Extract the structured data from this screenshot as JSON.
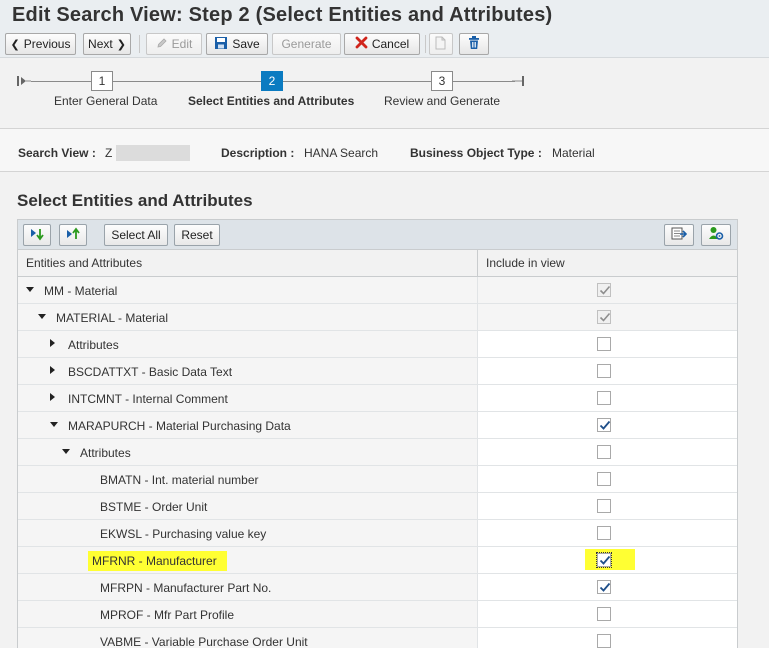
{
  "page": {
    "title": "Edit Search View: Step 2  (Select Entities and Attributes)"
  },
  "toolbar": {
    "previous": "Previous",
    "next": "Next",
    "edit": "Edit",
    "save": "Save",
    "generate": "Generate",
    "cancel": "Cancel",
    "icons": [
      "chevron-left-icon",
      "chevron-right-icon",
      "pencil-icon",
      "save-icon",
      "cancel-x-icon",
      "copy-icon",
      "trash-icon"
    ]
  },
  "roadmap": {
    "steps": [
      {
        "number": "1",
        "label": "Enter General Data",
        "active": false
      },
      {
        "number": "2",
        "label": "Select Entities and Attributes",
        "active": true
      },
      {
        "number": "3",
        "label": "Review and Generate",
        "active": false
      }
    ],
    "active_color": "#0b7bc1"
  },
  "header": {
    "search_view_label": "Search View :",
    "search_view_value": "Z",
    "description_label": "Description :",
    "description_value": "HANA Search",
    "bo_type_label": "Business Object Type :",
    "bo_type_value": "Material"
  },
  "section": {
    "title": "Select Entities and Attributes"
  },
  "table_toolbar": {
    "select_all": "Select All",
    "reset": "Reset",
    "icons": [
      "expand-down-icon",
      "collapse-up-icon",
      "export-icon",
      "user-settings-icon"
    ]
  },
  "table": {
    "columns": [
      "Entities and Attributes",
      "Include in view"
    ],
    "rows": [
      {
        "label": "MM - Material",
        "expander": "down",
        "checked": true,
        "disabled": true,
        "highlight": false
      },
      {
        "label": "MATERIAL - Material",
        "expander": "down",
        "checked": true,
        "disabled": true,
        "highlight": false
      },
      {
        "label": "Attributes",
        "expander": "right",
        "checked": false,
        "disabled": false,
        "highlight": false
      },
      {
        "label": "BSCDATTXT - Basic Data Text",
        "expander": "right",
        "checked": false,
        "disabled": false,
        "highlight": false
      },
      {
        "label": "INTCMNT - Internal Comment",
        "expander": "right",
        "checked": false,
        "disabled": false,
        "highlight": false
      },
      {
        "label": "MARAPURCH - Material Purchasing Data",
        "expander": "down",
        "checked": true,
        "disabled": false,
        "highlight": false
      },
      {
        "label": "Attributes",
        "expander": "down",
        "checked": false,
        "disabled": false,
        "highlight": false
      },
      {
        "label": "BMATN - Int. material number",
        "expander": "none",
        "checked": false,
        "disabled": false,
        "highlight": false
      },
      {
        "label": "BSTME - Order Unit",
        "expander": "none",
        "checked": false,
        "disabled": false,
        "highlight": false
      },
      {
        "label": "EKWSL - Purchasing value key",
        "expander": "none",
        "checked": false,
        "disabled": false,
        "highlight": false
      },
      {
        "label": "MFRNR - Manufacturer",
        "expander": "none",
        "checked": true,
        "disabled": false,
        "highlight": true
      },
      {
        "label": "MFRPN - Manufacturer Part No.",
        "expander": "none",
        "checked": true,
        "disabled": false,
        "highlight": false
      },
      {
        "label": "MPROF - Mfr Part Profile",
        "expander": "none",
        "checked": false,
        "disabled": false,
        "highlight": false
      },
      {
        "label": "VABME - Variable Purchase Order Unit",
        "expander": "none",
        "checked": false,
        "disabled": false,
        "highlight": false
      }
    ],
    "highlight_color": "#ffff33"
  }
}
